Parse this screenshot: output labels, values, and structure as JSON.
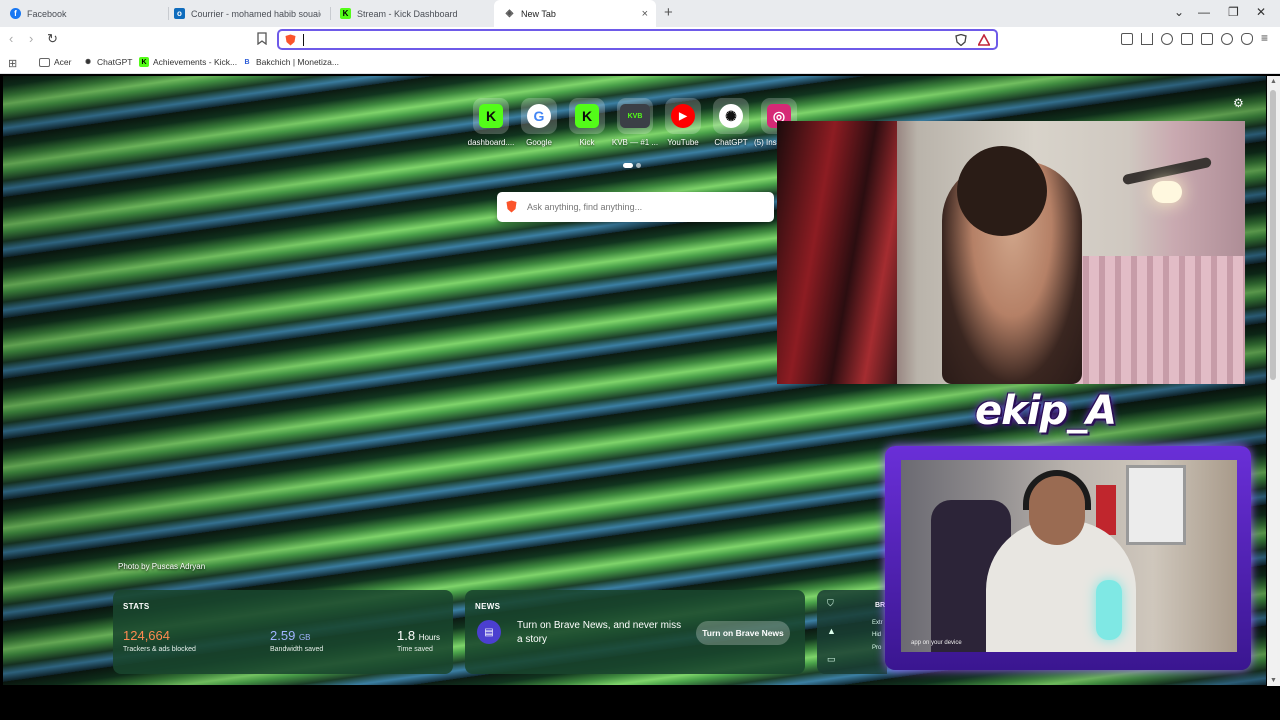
{
  "tabs": [
    {
      "title": "Facebook",
      "icon": "facebook-icon",
      "color": "#1877f2",
      "glyph": "f"
    },
    {
      "title": "Courrier - mohamed habib souaied -",
      "icon": "outlook-icon",
      "color": "#0f6cbd",
      "glyph": "o"
    },
    {
      "title": "Stream - Kick Dashboard",
      "icon": "kick-icon",
      "color": "#53fc18",
      "glyph": "K"
    },
    {
      "title": "New Tab",
      "icon": "brave-icon",
      "color": "#555555",
      "glyph": "◈",
      "close": "×"
    }
  ],
  "new_tab_glyph": "+",
  "window_controls": {
    "dropdown": "⌄",
    "minimize": "—",
    "restore": "❐",
    "close": "✕"
  },
  "toolbar": {
    "back": "‹",
    "forward": "›",
    "reload": "↻",
    "address_value": "",
    "accent": "#6e5ae8"
  },
  "bookmarks": [
    {
      "label": "Acer",
      "icon": "folder-icon",
      "glyph": "▭",
      "color": "#555555"
    },
    {
      "label": "ChatGPT",
      "icon": "chatgpt-icon",
      "glyph": "✺",
      "color": "#333333"
    },
    {
      "label": "Achievements - Kick...",
      "icon": "kick-icon",
      "glyph": "K",
      "color": "#53fc18"
    },
    {
      "label": "Bakchich | Monetiza...",
      "icon": "bakchich-icon",
      "glyph": "B",
      "color": "#2a5bd7"
    }
  ],
  "top_sites": [
    {
      "label": "dashboard....",
      "icon": "kick-icon",
      "glyph": "K",
      "bg": "#53fc18",
      "fg": "#0b0b0b"
    },
    {
      "label": "Google",
      "icon": "google-icon",
      "glyph": "G",
      "bg": "#ffffff",
      "fg": "#4285f4"
    },
    {
      "label": "Kick",
      "icon": "kick-icon",
      "glyph": "K",
      "bg": "#53fc18",
      "fg": "#0b0b0b"
    },
    {
      "label": "KVB — #1 ...",
      "icon": "kvb-icon",
      "glyph": "KVB",
      "bg": "#3b3f46",
      "fg": "#53fc18"
    },
    {
      "label": "YouTube",
      "icon": "youtube-icon",
      "glyph": "▶",
      "bg": "#ff0000",
      "fg": "#ffffff"
    },
    {
      "label": "ChatGPT",
      "icon": "chatgpt-icon",
      "glyph": "✺",
      "bg": "#ffffff",
      "fg": "#111111"
    },
    {
      "label": "(5) Ins",
      "icon": "instagram-icon",
      "glyph": "◎",
      "bg": "#d62976",
      "fg": "#ffffff"
    }
  ],
  "search": {
    "placeholder": "Ask anything, find anything..."
  },
  "settings_glyph": "⚙",
  "photo_credit": "Photo by Puscas Adryan",
  "stats": {
    "heading": "STATS",
    "trackers_value": "124,664",
    "trackers_label": "Trackers & ads blocked",
    "trackers_color": "#ff8a50",
    "bandwidth_value": "2.59",
    "bandwidth_unit": "GB",
    "bandwidth_label": "Bandwidth saved",
    "bandwidth_color": "#a0b4ff",
    "time_value": "1.8",
    "time_unit": "Hours",
    "time_label": "Time saved"
  },
  "news": {
    "heading": "NEWS",
    "text": "Turn on Brave News, and never miss a story",
    "button": "Turn on Brave News"
  },
  "side_card": {
    "label": "BR",
    "items": [
      "Extr",
      "Hid",
      "Pro"
    ]
  },
  "overlay": {
    "streamer_name": "ekip_A",
    "cam2_caption": "app on your device"
  }
}
